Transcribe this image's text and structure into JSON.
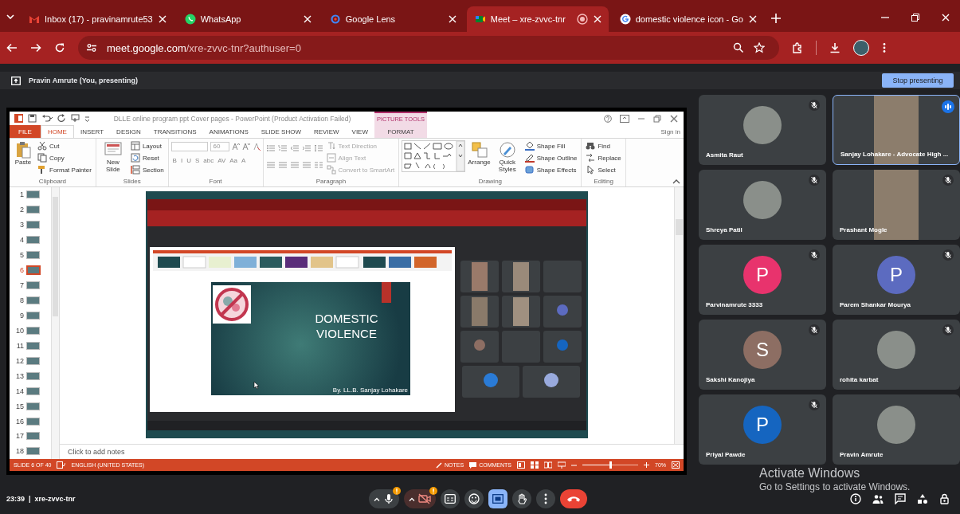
{
  "browser": {
    "tabs": [
      {
        "title": "Inbox (17) - pravinamrute53",
        "selected": false,
        "recording": false
      },
      {
        "title": "WhatsApp",
        "selected": false,
        "recording": false
      },
      {
        "title": "Google Lens",
        "selected": false,
        "recording": false
      },
      {
        "title": "Meet – xre-zvvc-tnr",
        "selected": true,
        "recording": true
      },
      {
        "title": "domestic violence icon - Go",
        "selected": false,
        "recording": false
      }
    ],
    "url": {
      "host": "meet.google.com",
      "path": "/xre-zvvc-tnr?authuser=0"
    }
  },
  "presenting_bar": {
    "label": "Pravin Amrute (You, presenting)",
    "button": "Stop presenting"
  },
  "powerpoint": {
    "title": "DLLE online program ppt Cover pages - PowerPoint (Product Activation Failed)",
    "context_group": "PICTURE TOOLS",
    "account": "Sign in",
    "tabs": [
      {
        "label": "FILE",
        "kind": "file",
        "selected": false
      },
      {
        "label": "HOME",
        "kind": "tab",
        "selected": true
      },
      {
        "label": "INSERT",
        "kind": "tab",
        "selected": false
      },
      {
        "label": "DESIGN",
        "kind": "tab",
        "selected": false
      },
      {
        "label": "TRANSITIONS",
        "kind": "tab",
        "selected": false
      },
      {
        "label": "ANIMATIONS",
        "kind": "tab",
        "selected": false
      },
      {
        "label": "SLIDE SHOW",
        "kind": "tab",
        "selected": false
      },
      {
        "label": "REVIEW",
        "kind": "tab",
        "selected": false
      },
      {
        "label": "VIEW",
        "kind": "tab",
        "selected": false
      },
      {
        "label": "FORMAT",
        "kind": "context",
        "selected": false
      }
    ],
    "groups": [
      {
        "label": "Clipboard",
        "items": [
          {
            "kind": "large",
            "label": "Paste",
            "disabled": false
          },
          {
            "kind": "small",
            "label": "Cut",
            "disabled": false
          },
          {
            "kind": "small",
            "label": "Copy",
            "disabled": false
          },
          {
            "kind": "small",
            "label": "Format Painter",
            "disabled": false
          }
        ]
      },
      {
        "label": "Slides",
        "items": [
          {
            "kind": "large",
            "label": "New Slide",
            "disabled": false
          },
          {
            "kind": "small",
            "label": "Layout",
            "disabled": false
          },
          {
            "kind": "small",
            "label": "Reset",
            "disabled": false
          },
          {
            "kind": "small",
            "label": "Section",
            "disabled": false
          }
        ]
      },
      {
        "label": "Font",
        "items": [
          {
            "kind": "font_fields",
            "size": "60"
          },
          {
            "kind": "glyphs",
            "glyphs": [
              "B",
              "I",
              "U",
              "S",
              "abc",
              "AV",
              "Aa",
              "A"
            ]
          }
        ]
      },
      {
        "label": "Paragraph",
        "items": [
          {
            "kind": "para_icons"
          },
          {
            "kind": "small",
            "label": "Text Direction",
            "disabled": true
          },
          {
            "kind": "small",
            "label": "Align Text",
            "disabled": true
          },
          {
            "kind": "small",
            "label": "Convert to SmartArt",
            "disabled": true
          }
        ]
      },
      {
        "label": "Drawing",
        "items": [
          {
            "kind": "shapes"
          },
          {
            "kind": "large",
            "label": "Arrange",
            "disabled": false
          },
          {
            "kind": "large",
            "label": "Quick Styles",
            "disabled": false
          },
          {
            "kind": "small",
            "label": "Shape Fill",
            "disabled": false
          },
          {
            "kind": "small",
            "label": "Shape Outline",
            "disabled": false
          },
          {
            "kind": "small",
            "label": "Shape Effects",
            "disabled": false
          }
        ]
      },
      {
        "label": "Editing",
        "items": [
          {
            "kind": "small",
            "label": "Find",
            "disabled": false
          },
          {
            "kind": "small",
            "label": "Replace",
            "disabled": false
          },
          {
            "kind": "small",
            "label": "Select",
            "disabled": false
          }
        ]
      }
    ],
    "thumbnails": [
      {
        "number": "1",
        "selected": false
      },
      {
        "number": "2",
        "selected": false
      },
      {
        "number": "3",
        "selected": false
      },
      {
        "number": "4",
        "selected": false
      },
      {
        "number": "5",
        "selected": false
      },
      {
        "number": "6",
        "selected": true
      },
      {
        "number": "7",
        "selected": false
      },
      {
        "number": "8",
        "selected": false
      },
      {
        "number": "9",
        "selected": false
      },
      {
        "number": "10",
        "selected": false
      },
      {
        "number": "11",
        "selected": false
      },
      {
        "number": "12",
        "selected": false
      },
      {
        "number": "13",
        "selected": false
      },
      {
        "number": "14",
        "selected": false
      },
      {
        "number": "15",
        "selected": false
      },
      {
        "number": "16",
        "selected": false
      },
      {
        "number": "17",
        "selected": false
      },
      {
        "number": "18",
        "selected": false
      }
    ],
    "slide": {
      "title": "DOMESTIC VIOLENCE",
      "byline": "By. LL.B. Sanjay Lohakare"
    },
    "notes_placeholder": "Click to add notes",
    "status": {
      "slide_indicator": "SLIDE 6 OF 40",
      "language": "ENGLISH (UNITED STATES)",
      "notes": "NOTES",
      "comments": "COMMENTS",
      "zoom": {
        "level": 0.5,
        "reading": "70%"
      }
    }
  },
  "participants": [
    {
      "name": "Asmita Raut",
      "muted": true,
      "speaking": false,
      "avatar": {
        "kind": "photo"
      }
    },
    {
      "name": "Sanjay Lohakare - Advocate High ...",
      "muted": false,
      "speaking": true,
      "avatar": {
        "kind": "video"
      }
    },
    {
      "name": "Shreya Patil",
      "muted": true,
      "speaking": false,
      "avatar": {
        "kind": "photo"
      }
    },
    {
      "name": "Prashant Mogle",
      "muted": true,
      "speaking": false,
      "avatar": {
        "kind": "video"
      }
    },
    {
      "name": "Parvinamrute 3333",
      "muted": true,
      "speaking": false,
      "avatar": {
        "kind": "letter",
        "letter": "P",
        "color": "#e8336d"
      }
    },
    {
      "name": "Parem Shankar Mourya",
      "muted": true,
      "speaking": false,
      "avatar": {
        "kind": "letter",
        "letter": "P",
        "color": "#5c6bc0"
      }
    },
    {
      "name": "Sakshi Kanojiya",
      "muted": true,
      "speaking": false,
      "avatar": {
        "kind": "letter",
        "letter": "S",
        "color": "#8d6e63"
      }
    },
    {
      "name": "rohita karbat",
      "muted": true,
      "speaking": false,
      "avatar": {
        "kind": "photo"
      }
    },
    {
      "name": "Priyal Pawde",
      "muted": true,
      "speaking": false,
      "avatar": {
        "kind": "letter",
        "letter": "P",
        "color": "#1565c0"
      }
    },
    {
      "name": "Pravin Amrute",
      "muted": false,
      "speaking": false,
      "avatar": {
        "kind": "photo"
      }
    }
  ],
  "call_bar": {
    "time": "23:39",
    "separator": "|",
    "meeting_code": "xre-zvvc-tnr",
    "controls": [
      {
        "kind": "mic",
        "on": true,
        "alert": true
      },
      {
        "kind": "camera",
        "on": false,
        "alert": true
      },
      {
        "kind": "captions",
        "on": false
      },
      {
        "kind": "emoji"
      },
      {
        "kind": "present",
        "on": true
      },
      {
        "kind": "hand"
      },
      {
        "kind": "more"
      },
      {
        "kind": "leave"
      }
    ],
    "side_controls": [
      {
        "kind": "info"
      },
      {
        "kind": "people"
      },
      {
        "kind": "chat"
      },
      {
        "kind": "activities"
      },
      {
        "kind": "host"
      }
    ]
  },
  "activation_notice": {
    "title": "Activate Windows",
    "hint": "Go to Settings to activate Windows."
  }
}
